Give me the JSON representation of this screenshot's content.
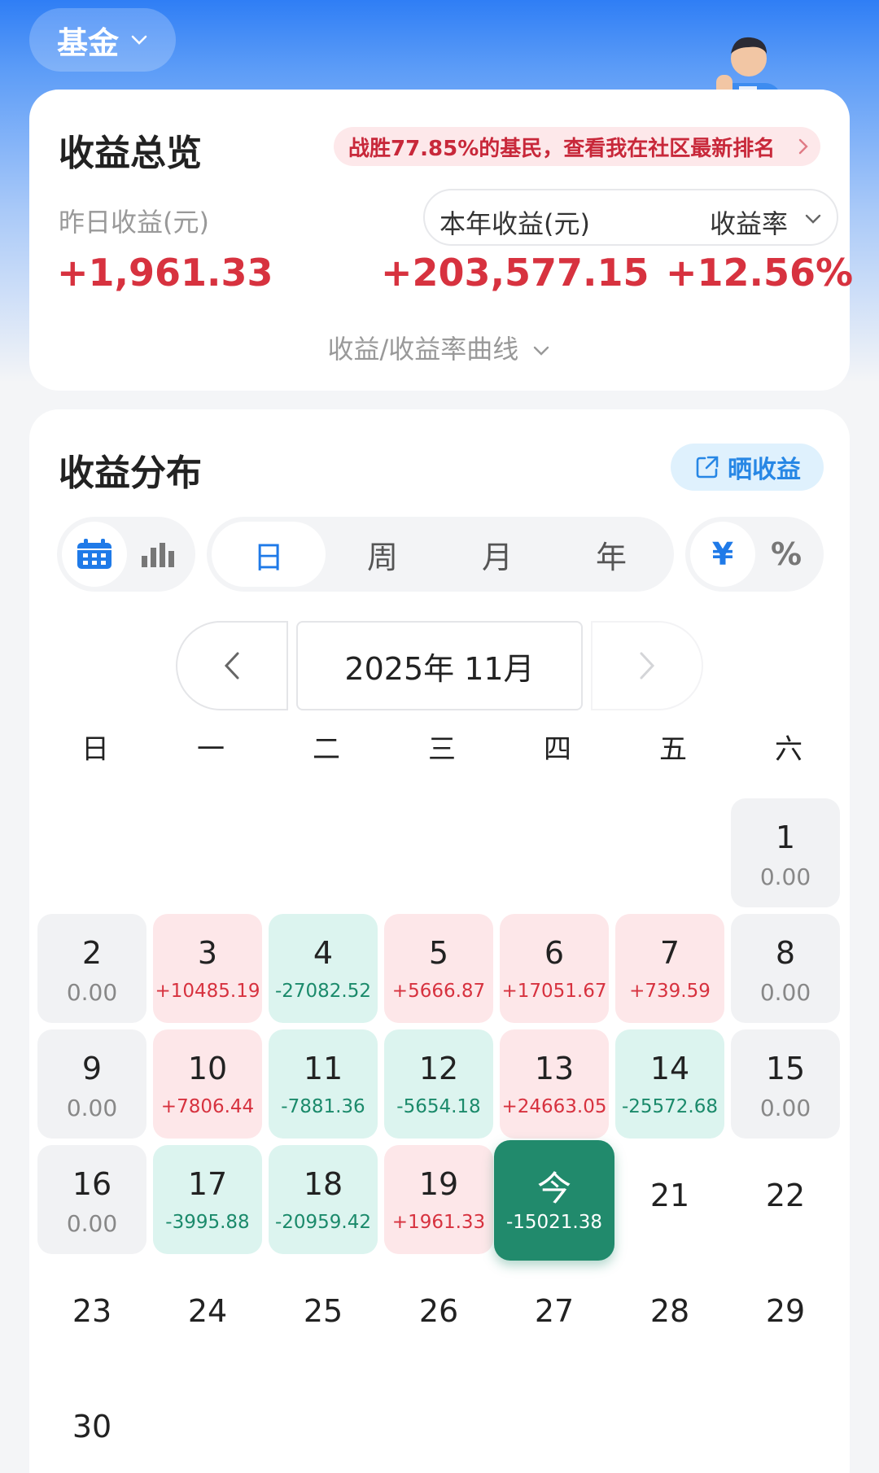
{
  "header": {
    "fund_selector": "基金"
  },
  "overview": {
    "title": "收益总览",
    "rank_banner": "战胜77.85%的基民，查看我在社区最新排名",
    "yesterday_label": "昨日收益(元)",
    "year_label": "本年收益(元)",
    "rate_label": "收益率",
    "yesterday_value": "+1,961.33",
    "year_value": "+203,577.15",
    "rate_value": "+12.56%",
    "curve_toggle": "收益/收益率曲线"
  },
  "distribution": {
    "title": "收益分布",
    "share_label": "晒收益",
    "periods": [
      "日",
      "周",
      "月",
      "年"
    ],
    "units": [
      "¥",
      "%"
    ],
    "month_label": "2025年 11月",
    "weekdays": [
      "日",
      "一",
      "二",
      "三",
      "四",
      "五",
      "六"
    ],
    "days": [
      {
        "d": "1",
        "v": "0.00"
      },
      {
        "d": "2",
        "v": "0.00"
      },
      {
        "d": "3",
        "v": "+10485.19"
      },
      {
        "d": "4",
        "v": "-27082.52"
      },
      {
        "d": "5",
        "v": "+5666.87"
      },
      {
        "d": "6",
        "v": "+17051.67"
      },
      {
        "d": "7",
        "v": "+739.59"
      },
      {
        "d": "8",
        "v": "0.00"
      },
      {
        "d": "9",
        "v": "0.00"
      },
      {
        "d": "10",
        "v": "+7806.44"
      },
      {
        "d": "11",
        "v": "-7881.36"
      },
      {
        "d": "12",
        "v": "-5654.18"
      },
      {
        "d": "13",
        "v": "+24663.05"
      },
      {
        "d": "14",
        "v": "-25572.68"
      },
      {
        "d": "15",
        "v": "0.00"
      },
      {
        "d": "16",
        "v": "0.00"
      },
      {
        "d": "17",
        "v": "-3995.88"
      },
      {
        "d": "18",
        "v": "-20959.42"
      },
      {
        "d": "19",
        "v": "+1961.33"
      },
      {
        "d": "今",
        "v": "-15021.38"
      },
      {
        "d": "21",
        "v": ""
      },
      {
        "d": "22",
        "v": ""
      },
      {
        "d": "23",
        "v": ""
      },
      {
        "d": "24",
        "v": ""
      },
      {
        "d": "25",
        "v": ""
      },
      {
        "d": "26",
        "v": ""
      },
      {
        "d": "27",
        "v": ""
      },
      {
        "d": "28",
        "v": ""
      },
      {
        "d": "29",
        "v": ""
      },
      {
        "d": "30",
        "v": ""
      }
    ]
  },
  "colors": {
    "accent_blue": "#1f7ae8",
    "gain_red": "#d7323f",
    "loss_green": "#1b8a6b",
    "today_green": "#218a6c"
  },
  "icons": [
    "chevron-down-icon",
    "chevron-right-icon",
    "share-icon",
    "calendar-icon",
    "bar-chart-icon",
    "chevron-left-icon"
  ]
}
